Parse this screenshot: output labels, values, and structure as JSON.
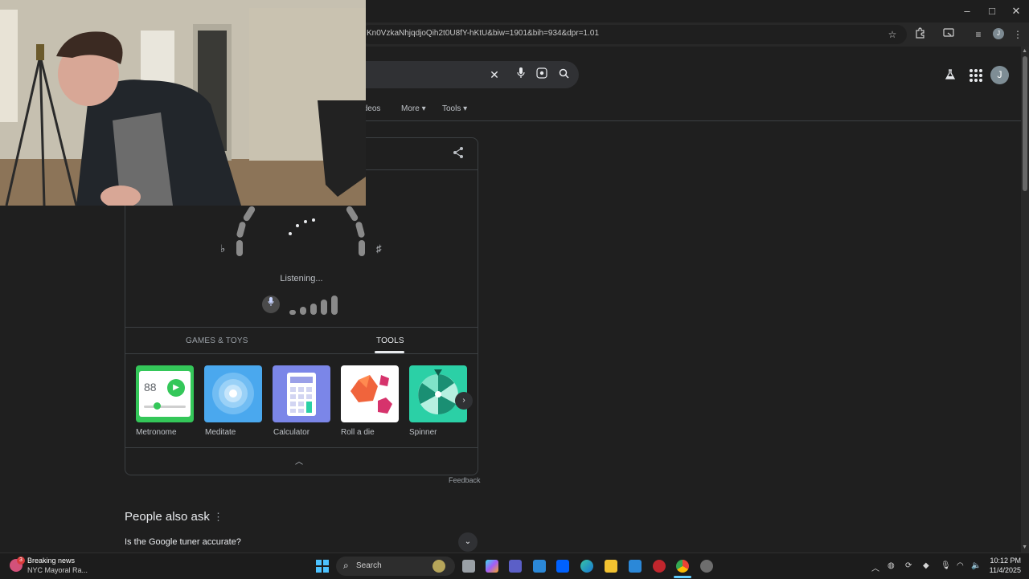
{
  "browser": {
    "url": "Kn0VzkaNhjqdjoQih2t0U8fY-hKtU&biw=1901&bih=934&dpr=1.01",
    "window_controls": {
      "minimize": "–",
      "maximize": "□",
      "close": "✕"
    },
    "profile_initial": "J"
  },
  "google": {
    "avatar_initial": "J",
    "nav_tabs": [
      "Videos",
      "More",
      "Tools"
    ]
  },
  "tuner": {
    "flat_symbol": "♭",
    "sharp_symbol": "♯",
    "status": "Listening...",
    "mic_level_bars": 5,
    "categories": [
      {
        "label": "GAMES & TOYS",
        "active": false
      },
      {
        "label": "TOOLS",
        "active": true
      }
    ],
    "tools": [
      {
        "label": "Metronome",
        "tile_text": "88"
      },
      {
        "label": "Meditate"
      },
      {
        "label": "Calculator"
      },
      {
        "label": "Roll a die"
      },
      {
        "label": "Spinner"
      }
    ],
    "feedback": "Feedback"
  },
  "people_also_ask": {
    "title": "People also ask",
    "questions": [
      "Is the Google tuner accurate?"
    ]
  },
  "taskbar": {
    "news_badge": "3",
    "news_title": "Breaking news",
    "news_subtitle": "NYC Mayoral Ra...",
    "search_label": "Search",
    "time": "10:12 PM",
    "date": "11/4/2025"
  },
  "colors": {
    "page_bg": "#1f1f1f",
    "metronome": "#34c759",
    "meditate": "#4aa8ee",
    "calculator": "#7b86e8",
    "spinner": "#2bd0a6"
  }
}
